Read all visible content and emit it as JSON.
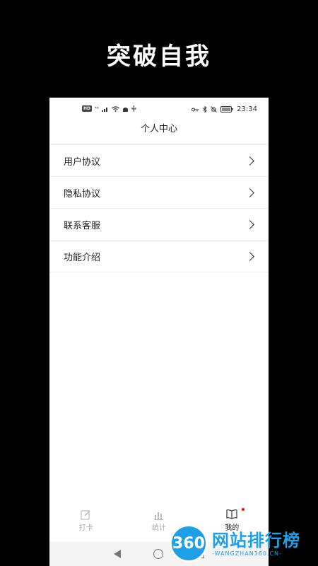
{
  "banner": {
    "title": "突破自我"
  },
  "status_bar": {
    "time": "23:34",
    "hd": "HD",
    "signal": "⁴⁶"
  },
  "page": {
    "title": "个人中心"
  },
  "menu": {
    "items": [
      {
        "label": "用户协议"
      },
      {
        "label": "隐私协议"
      },
      {
        "label": "联系客服"
      },
      {
        "label": "功能介绍"
      }
    ]
  },
  "tabbar": {
    "tabs": [
      {
        "label": "打卡",
        "icon": "edit-icon",
        "active": false
      },
      {
        "label": "统计",
        "icon": "bar-chart-icon",
        "active": false
      },
      {
        "label": "我的",
        "icon": "book-icon",
        "active": true
      }
    ]
  },
  "watermark": {
    "logo": "360",
    "main": "网站排行榜",
    "sub": "-WANGZHAN360.CN-"
  },
  "colors": {
    "accent_red": "#e00000",
    "watermark_blue": "#1fa0e6"
  }
}
